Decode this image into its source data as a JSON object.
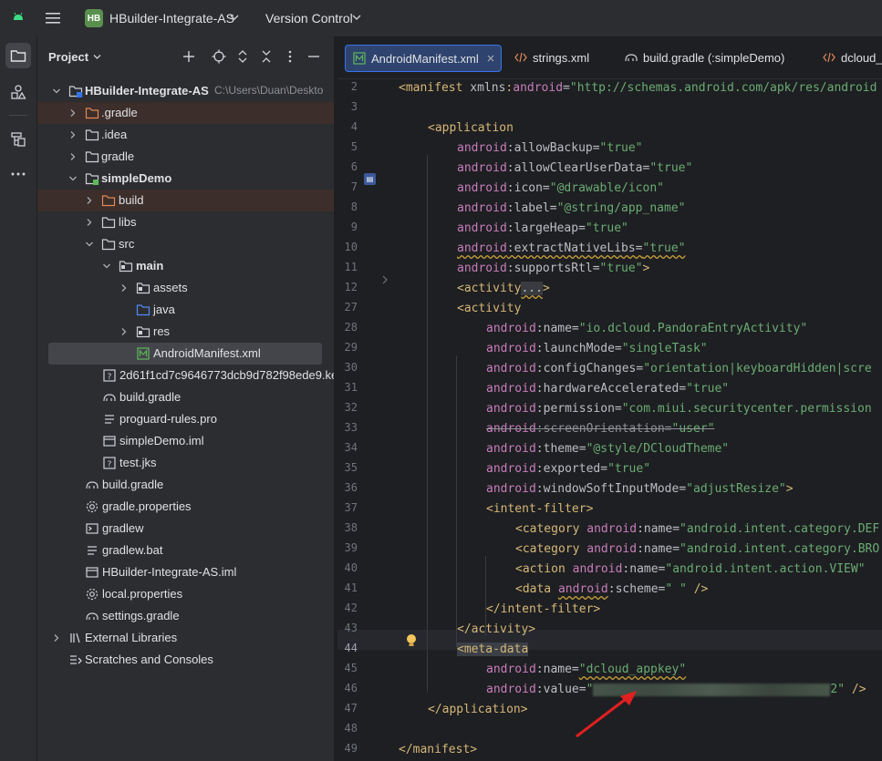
{
  "titlebar": {
    "project_badge": "HB",
    "project_name": "HBuilder-Integrate-AS",
    "version_control": "Version Control"
  },
  "project_panel": {
    "title": "Project",
    "tree": [
      {
        "label": "HBuilder-Integrate-AS",
        "extra": "C:\\Users\\Duan\\Deskto",
        "bold": true
      },
      {
        "label": ".gradle"
      },
      {
        "label": ".idea"
      },
      {
        "label": "gradle"
      },
      {
        "label": "simpleDemo",
        "bold": true
      },
      {
        "label": "build"
      },
      {
        "label": "libs"
      },
      {
        "label": "src"
      },
      {
        "label": "main",
        "bold": true
      },
      {
        "label": "assets"
      },
      {
        "label": "java"
      },
      {
        "label": "res"
      },
      {
        "label": "AndroidManifest.xml"
      },
      {
        "label": "2d61f1cd7c9646773dcb9d782f98ede9.ke"
      },
      {
        "label": "build.gradle"
      },
      {
        "label": "proguard-rules.pro"
      },
      {
        "label": "simpleDemo.iml"
      },
      {
        "label": "test.jks"
      },
      {
        "label": "build.gradle"
      },
      {
        "label": "gradle.properties"
      },
      {
        "label": "gradlew"
      },
      {
        "label": "gradlew.bat"
      },
      {
        "label": "HBuilder-Integrate-AS.iml"
      },
      {
        "label": "local.properties"
      },
      {
        "label": "settings.gradle"
      },
      {
        "label": "External Libraries"
      },
      {
        "label": "Scratches and Consoles"
      }
    ]
  },
  "tabs": [
    {
      "label": "AndroidManifest.xml",
      "active": true
    },
    {
      "label": "strings.xml"
    },
    {
      "label": "build.gradle (:simpleDemo)"
    },
    {
      "label": "dcloud_"
    }
  ],
  "line_numbers": [
    "2",
    "3",
    "4",
    "5",
    "6",
    "7",
    "8",
    "9",
    "10",
    "11",
    "12",
    "27",
    "28",
    "29",
    "30",
    "31",
    "32",
    "33",
    "34",
    "35",
    "36",
    "37",
    "38",
    "39",
    "40",
    "41",
    "42",
    "43",
    "44",
    "45",
    "46",
    "47",
    "48",
    "49"
  ],
  "code": {
    "l2_attr": "xmlns",
    "l2_val": "\"http://schemas.android.com/apk/res/android",
    "allowBackup": "\"true\"",
    "allowClearUserData": "\"true\"",
    "icon": "\"@drawable/icon\"",
    "label": "\"@string/app_name\"",
    "largeHeap": "\"true\"",
    "extractNativeLibs": "\"true\"",
    "supportsRtl": "\"true\"",
    "activity_name": "\"io.dcloud.PandoraEntryActivity\"",
    "launchMode": "\"singleTask\"",
    "configChanges": "\"orientation|keyboardHidden|scre",
    "hardwareAccelerated": "\"true\"",
    "permission": "\"com.miui.securitycenter.permission",
    "screenOrientation": "\"user\"",
    "theme": "\"@style/DCloudTheme\"",
    "exported": "\"true\"",
    "windowSoftInputMode": "\"adjustResize\"",
    "category1": "\"android.intent.category.DEF",
    "category2": "\"android.intent.category.BRO",
    "action": "\"android.intent.action.VIEW\" ",
    "scheme": "\" \"",
    "meta_name": "\"dcloud_appkey\"",
    "meta_value_open": "\"",
    "meta_value_close": "2\""
  }
}
